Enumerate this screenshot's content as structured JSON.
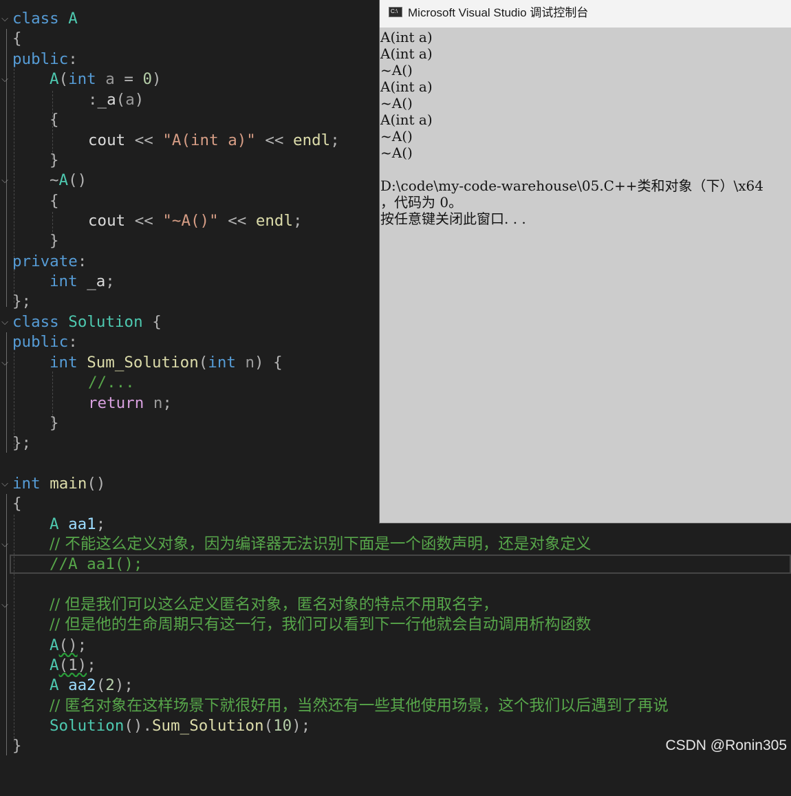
{
  "editor": {
    "lines": {
      "l1": {
        "kw1": "class",
        "ty1": "A"
      },
      "l2": {
        "p1": "{"
      },
      "l3": {
        "kw1": "public",
        "p1": ":"
      },
      "l4": {
        "ty1": "A",
        "p1": "(",
        "kw1": "int",
        "pm1": "a",
        "p2": " = ",
        "nm1": "0",
        "p3": ")"
      },
      "l5": {
        "p1": ":",
        "mb1": "_a",
        "p2": "(",
        "pm1": "a",
        "p3": ")"
      },
      "l6": {
        "p1": "{"
      },
      "l7": {
        "vr1": "cout",
        "p1": " << ",
        "st1": "\"A(int a)\"",
        "p2": " << ",
        "fn1": "endl",
        "p3": ";"
      },
      "l8": {
        "p1": "}"
      },
      "l9": {
        "p1": "~",
        "ty1": "A",
        "p2": "()"
      },
      "l10": {
        "p1": "{"
      },
      "l11": {
        "vr1": "cout",
        "p1": " << ",
        "st1": "\"~A()\"",
        "p2": " << ",
        "fn1": "endl",
        "p3": ";"
      },
      "l12": {
        "p1": "}"
      },
      "l13": {
        "kw1": "private",
        "p1": ":"
      },
      "l14": {
        "kw1": "int",
        "mb1": "_a",
        "p1": ";"
      },
      "l15": {
        "p1": "};"
      },
      "l16": {
        "kw1": "class",
        "ty1": "Solution",
        "p1": " {"
      },
      "l17": {
        "kw1": "public",
        "p1": ":"
      },
      "l18": {
        "kw1": "int",
        "fn1": "Sum_Solution",
        "p1": "(",
        "kw2": "int",
        "pm1": "n",
        "p2": ") {"
      },
      "l19": {
        "cm1": "//..."
      },
      "l20": {
        "ct1": "return",
        "pm1": "n",
        "p1": ";"
      },
      "l21": {
        "p1": "}"
      },
      "l22": {
        "p1": "};"
      },
      "l24": {
        "kw1": "int",
        "fn1": "main",
        "p1": "()"
      },
      "l25": {
        "p1": "{"
      },
      "l26": {
        "ty1": "A",
        "mb1": "aa1",
        "p1": ";"
      },
      "l27": {
        "cm1": "// 不能这么定义对象，因为编译器无法识别下面是一个函数声明，还是对象定义"
      },
      "l28": {
        "cm1": "//A aa1();"
      },
      "l30": {
        "cm1": "// 但是我们可以这么定义匿名对象，匿名对象的特点不用取名字，"
      },
      "l31": {
        "cm1": "// 但是他的生命周期只有这一行，我们可以看到下一行他就会自动调用析构函数"
      },
      "l32": {
        "ty1": "A",
        "p1": "()",
        "p2": ";"
      },
      "l33": {
        "ty1": "A",
        "p1": "(1)",
        "p2": ";"
      },
      "l34": {
        "ty1": "A",
        "mb1": "aa2",
        "p1": "(",
        "nm1": "2",
        "p2": ");"
      },
      "l35": {
        "cm1": "// 匿名对象在这样场景下就很好用，当然还有一些其他使用场景，这个我们以后遇到了再说"
      },
      "l36": {
        "ty1": "Solution",
        "p1": "().",
        "fn1": "Sum_Solution",
        "p2": "(",
        "nm1": "10",
        "p3": ");"
      },
      "l37": {
        "p1": "}"
      }
    }
  },
  "console": {
    "title": "Microsoft Visual Studio 调试控制台",
    "icon_text": "C:\\",
    "output": [
      "A(int a)",
      "A(int a)",
      "~A()",
      "A(int a)",
      "~A()",
      "A(int a)",
      "~A()",
      "~A()",
      "",
      "D:\\code\\my-code-warehouse\\05.C++类和对象（下）\\x64",
      "，代码为 0。",
      "按任意键关闭此窗口. . ."
    ]
  },
  "watermark": "CSDN @Ronin305",
  "colors": {
    "editor_bg": "#1e1e1e",
    "keyword": "#569cd6",
    "type": "#4ec9b0",
    "function": "#dcdcaa",
    "string": "#d69d85",
    "comment": "#57a64a",
    "control": "#d8a0df",
    "console_bg": "#cccccc"
  }
}
